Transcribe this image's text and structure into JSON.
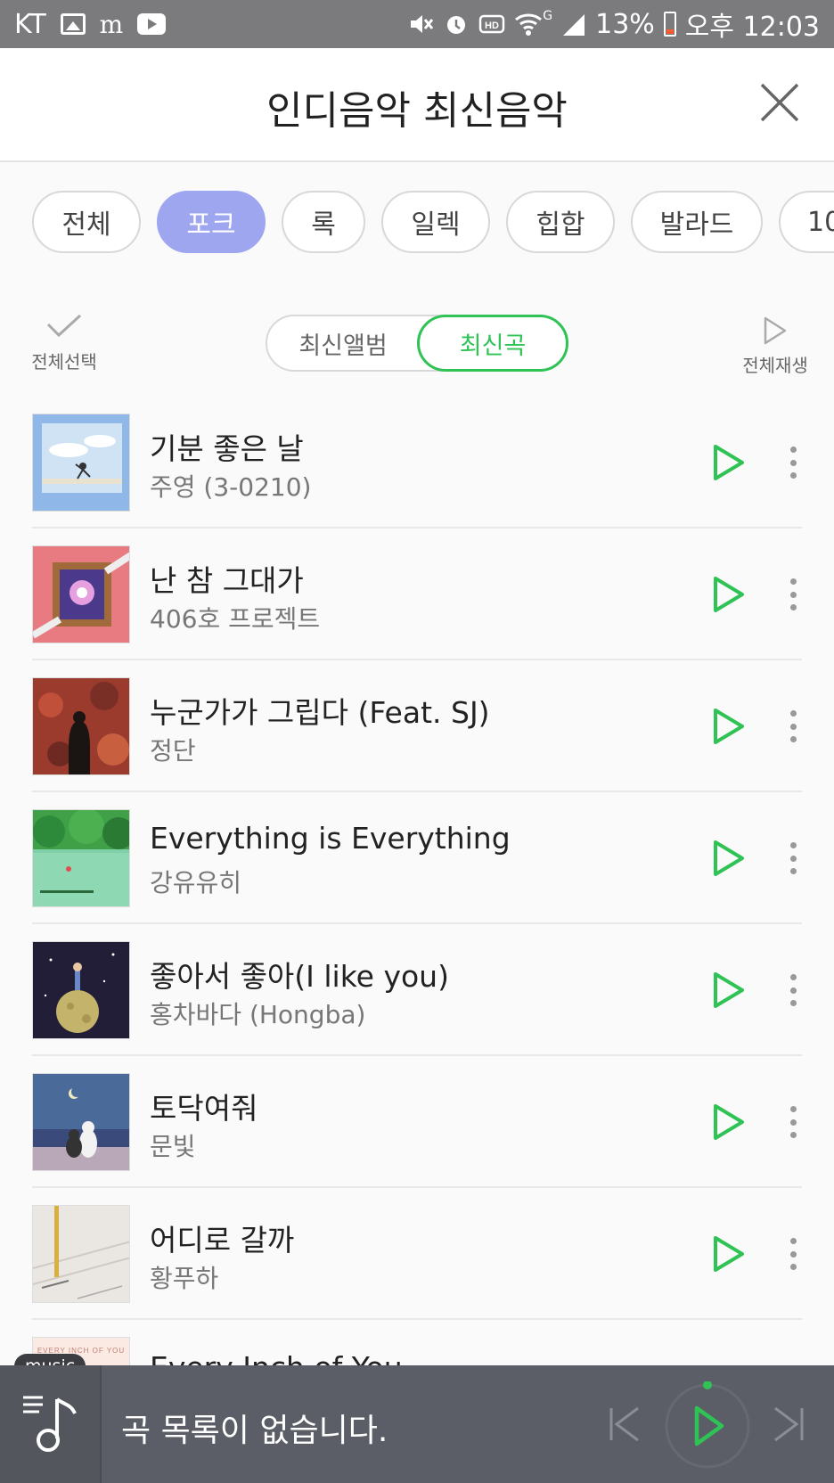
{
  "status_bar": {
    "carrier": "KT",
    "notification_text": "m",
    "battery": "13%",
    "time": "오후 12:03",
    "network": "G"
  },
  "header": {
    "title": "인디음악 최신음악"
  },
  "genres": [
    "전체",
    "포크",
    "록",
    "일렉",
    "힙합",
    "발라드",
    "10"
  ],
  "active_genre": "포크",
  "controls": {
    "select_all": "전체선택",
    "tab_album": "최신앨범",
    "tab_song": "최신곡",
    "play_all": "전체재생"
  },
  "songs": [
    {
      "title": "기분 좋은 날",
      "artist": "주영 (3-0210)",
      "art": "sky"
    },
    {
      "title": "난 참 그대가",
      "artist": "406호 프로젝트",
      "art": "pink"
    },
    {
      "title": "누군가가 그립다 (Feat. SJ)",
      "artist": "정단",
      "art": "leaves"
    },
    {
      "title": "Everything is Everything",
      "artist": "강유유히",
      "art": "forest"
    },
    {
      "title": "좋아서 좋아(I like you)",
      "artist": "홍차바다 (Hongba)",
      "art": "moon"
    },
    {
      "title": "토닥여줘",
      "artist": "문빛",
      "art": "cats"
    },
    {
      "title": "어디로 갈까",
      "artist": "황푸하",
      "art": "snow"
    }
  ],
  "partial_song": {
    "title": "Every Inch of You",
    "art_text": "EVERY INCH OF YOU"
  },
  "player": {
    "tag": "music",
    "message": "곡 목록이 없습니다."
  },
  "colors": {
    "accent_green": "#2fc356",
    "chip_active": "#9ea6f0",
    "player_bg": "#5b5e66"
  }
}
